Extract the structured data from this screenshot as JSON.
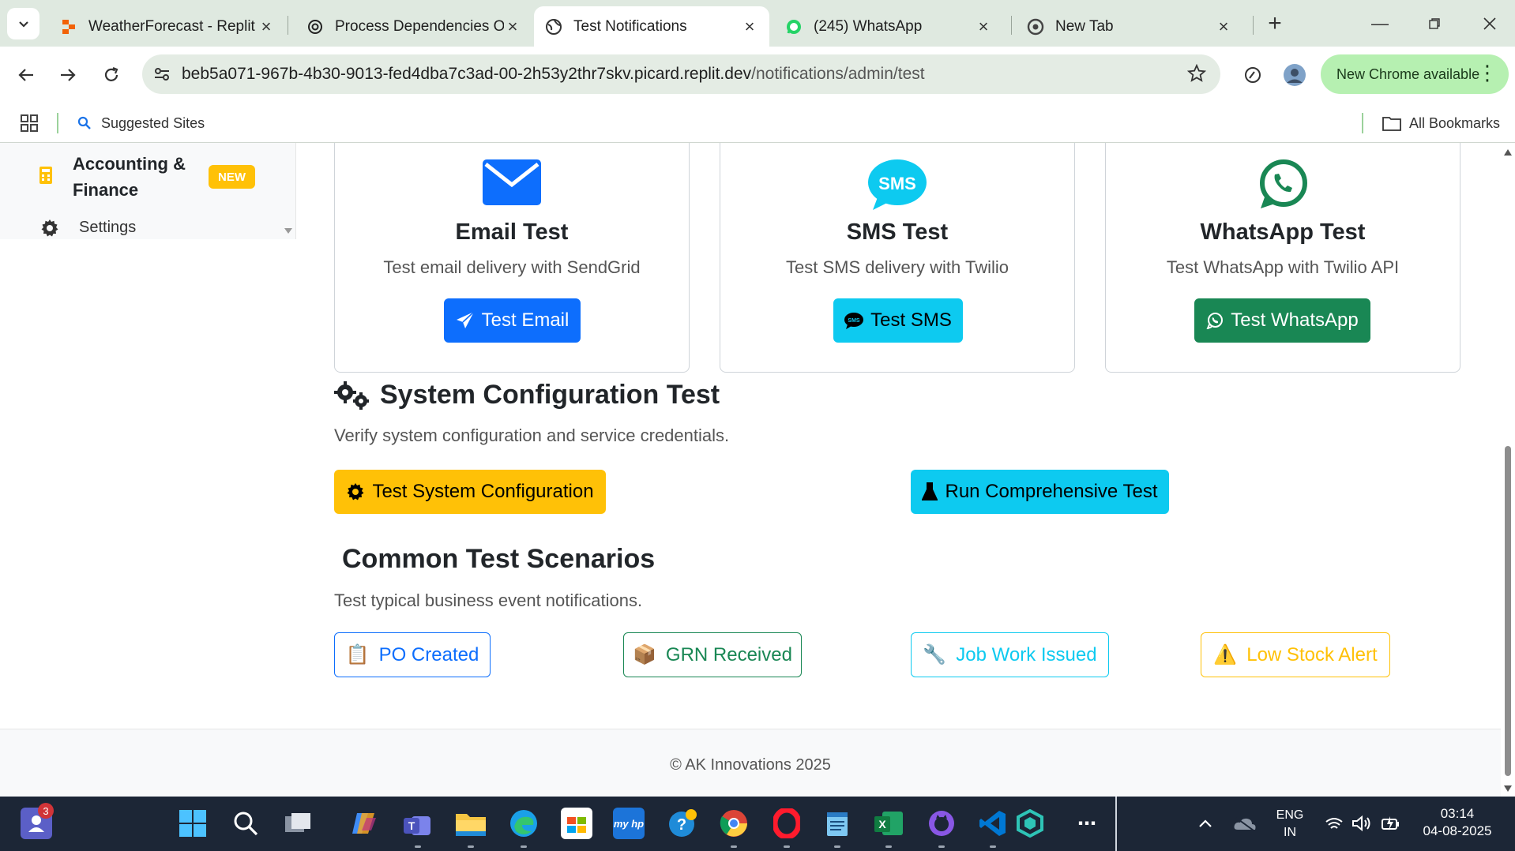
{
  "browser": {
    "tabs": [
      {
        "title": "WeatherForecast - Replit",
        "icon": "replit-icon",
        "active": false
      },
      {
        "title": "Process Dependencies O",
        "icon": "openai-icon",
        "active": false
      },
      {
        "title": "Test Notifications",
        "icon": "globe-icon",
        "active": true
      },
      {
        "title": "(245) WhatsApp",
        "icon": "whatsapp-icon",
        "active": false
      },
      {
        "title": "New Tab",
        "icon": "chrome-icon",
        "active": false
      }
    ],
    "url_host": "beb5a071-967b-4b30-9013-fed4dba7c3ad-00-2h53y2thr7skv.picard.replit.dev",
    "url_path": "/notifications/admin/test",
    "new_chrome_label": "New Chrome available",
    "bookmarks": {
      "suggested": "Suggested Sites",
      "all": "All Bookmarks"
    }
  },
  "sidebar": {
    "accounting_label_line1": "Accounting &",
    "accounting_label_line2": "Finance",
    "new_badge": "NEW",
    "settings_label": "Settings"
  },
  "cards": [
    {
      "title": "Email Test",
      "desc": "Test email delivery with SendGrid",
      "button": "Test Email",
      "color": "#0d6efd"
    },
    {
      "title": "SMS Test",
      "desc": "Test SMS delivery with Twilio",
      "button": "Test SMS",
      "color": "#0dcaf0"
    },
    {
      "title": "WhatsApp Test",
      "desc": "Test WhatsApp with Twilio API",
      "button": "Test WhatsApp",
      "color": "#198754"
    }
  ],
  "system": {
    "heading": "System Configuration Test",
    "desc": "Verify system configuration and service credentials.",
    "btn_config": "Test System Configuration",
    "btn_comprehensive": "Run Comprehensive Test"
  },
  "scenarios": {
    "heading": "Common Test Scenarios",
    "desc": "Test typical business event notifications.",
    "items": [
      {
        "label": "PO Created",
        "emoji": "📋",
        "color": "#0d6efd"
      },
      {
        "label": "GRN Received",
        "emoji": "📦",
        "color": "#198754"
      },
      {
        "label": "Job Work Issued",
        "emoji": "🔧",
        "color": "#0dcaf0"
      },
      {
        "label": "Low Stock Alert",
        "emoji": "⚠️",
        "color": "#ffc107"
      }
    ]
  },
  "footer": "© AK Innovations 2025",
  "taskbar": {
    "notification_count": "3",
    "lang_line1": "ENG",
    "lang_line2": "IN",
    "time": "03:14",
    "date": "04-08-2025"
  }
}
